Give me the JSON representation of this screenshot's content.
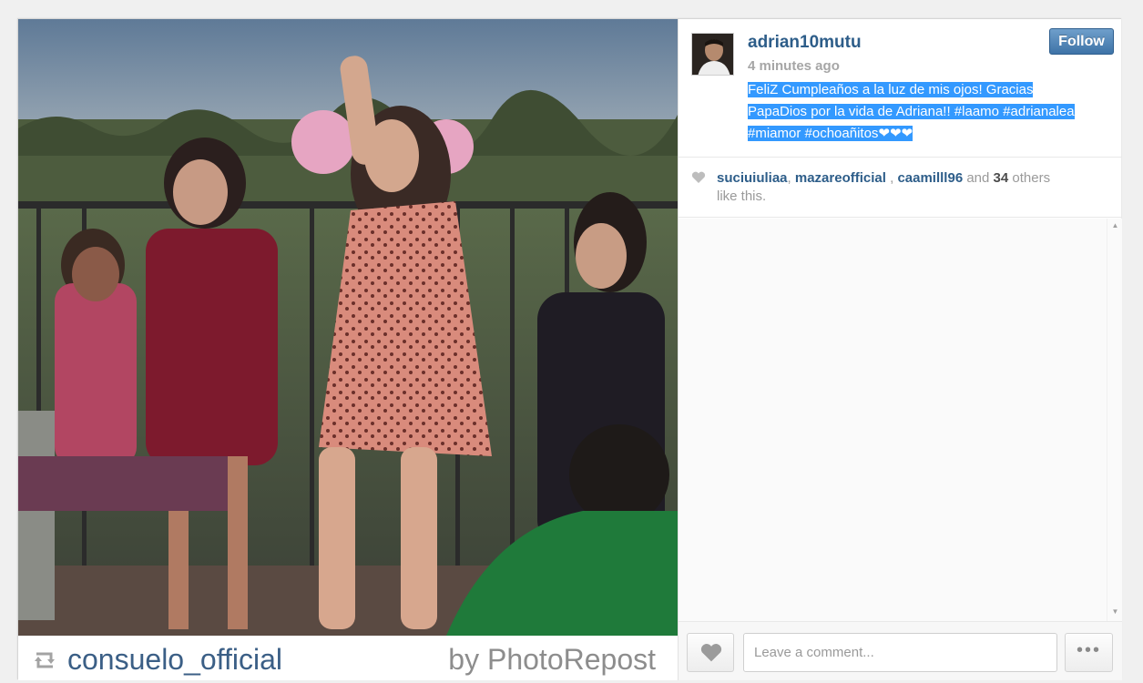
{
  "post": {
    "username": "adrian10mutu",
    "time_ago": "4 minutes ago",
    "follow_label": "Follow",
    "caption_lines": [
      "FeliZ Cumpleaños a la luz de mis ojos! Gracias",
      "PapaDios por la vida de Adriana!! #laamo #adrianalea",
      "#miamor #ochoañitos❤❤❤"
    ]
  },
  "likes": {
    "users": [
      "suciuiuliaa",
      "mazareofficial",
      "caamilll96"
    ],
    "sep": ",",
    "and_text": "and",
    "count": "34",
    "others_text": "others",
    "suffix": "like this."
  },
  "photo_overlay": {
    "repost_user": "consuelo_official",
    "repost_by": "by PhotoRepost"
  },
  "composer": {
    "placeholder": "Leave a comment...",
    "more_label": "•••"
  },
  "icons": {
    "repost": "repost-icon",
    "heart": "heart-icon",
    "scroll_up": "scroll-up-arrow-icon",
    "scroll_down": "scroll-down-arrow-icon"
  },
  "colors": {
    "link_blue": "#2d5d89",
    "follow_button": "#3e73a7",
    "selection_highlight": "#3399ff"
  }
}
